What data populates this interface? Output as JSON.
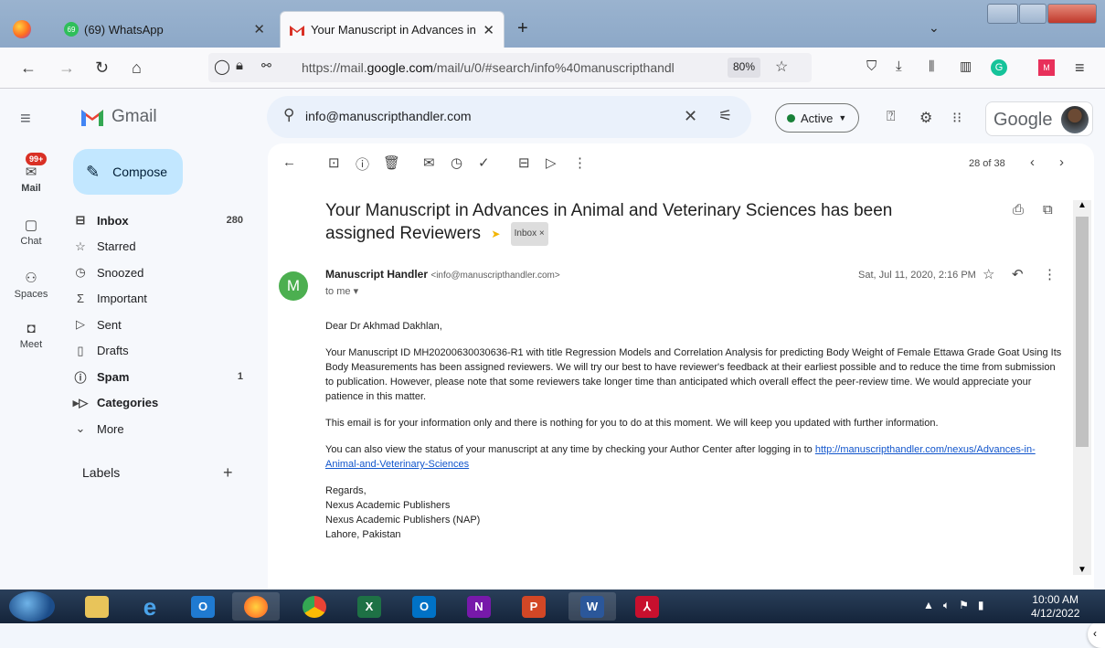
{
  "browser": {
    "tabs": [
      {
        "label": "(69) WhatsApp",
        "badge": "69"
      },
      {
        "label": "Your Manuscript in Advances in"
      }
    ],
    "url_prefix": "https://mail.",
    "url_domain": "google.com",
    "url_suffix": "/mail/u/0/#search/info%40manuscripthandl",
    "zoom": "80%"
  },
  "gmail": {
    "app_name": "Gmail",
    "rail": [
      {
        "label": "Mail",
        "badge": "99+"
      },
      {
        "label": "Chat"
      },
      {
        "label": "Spaces"
      },
      {
        "label": "Meet"
      }
    ],
    "compose_label": "Compose",
    "nav": [
      {
        "label": "Inbox",
        "count": "280",
        "bold": true,
        "icon": "inbox-icon"
      },
      {
        "label": "Starred",
        "count": "",
        "bold": false,
        "icon": "star-icon"
      },
      {
        "label": "Snoozed",
        "count": "",
        "bold": false,
        "icon": "clock-icon"
      },
      {
        "label": "Important",
        "count": "",
        "bold": false,
        "icon": "important-icon"
      },
      {
        "label": "Sent",
        "count": "",
        "bold": false,
        "icon": "send-icon"
      },
      {
        "label": "Drafts",
        "count": "",
        "bold": false,
        "icon": "draft-icon"
      },
      {
        "label": "Spam",
        "count": "1",
        "bold": true,
        "icon": "spam-icon"
      },
      {
        "label": "Categories",
        "count": "",
        "bold": true,
        "icon": "label-icon"
      },
      {
        "label": "More",
        "count": "",
        "bold": false,
        "icon": "chevron-down-icon"
      }
    ],
    "labels_heading": "Labels",
    "search_value": "info@manuscripthandler.com",
    "status": "Active",
    "account_brand": "Google",
    "pager": "28 of 38",
    "email": {
      "subject": "Your Manuscript in Advances in Animal and Veterinary Sciences has been assigned Reviewers",
      "label_chip": "Inbox ×",
      "avatar_letter": "M",
      "sender_name": "Manuscript Handler",
      "sender_email": "<info@manuscripthandler.com>",
      "to": "to me",
      "date": "Sat, Jul 11, 2020, 2:16 PM",
      "greeting": "Dear Dr Akhmad Dakhlan,",
      "para1": "Your Manuscript ID MH20200630030636-R1 with title Regression Models and Correlation Analysis for predicting Body Weight of Female Ettawa Grade Goat Using Its Body Measurements has been assigned reviewers. We will try our best to have reviewer's feedback at their earliest possible and to reduce the time from submission to publication. However, please note that some reviewers take longer time than anticipated which overall effect the peer-review time. We would appreciate your patience in this matter.",
      "para2": "This email is for your information only and there is nothing for you to do at this moment. We will keep you updated with further information.",
      "para3": "You can also view the status of your manuscript at any time by checking your Author Center after logging in to",
      "link": "http://manuscripthandler.com/nexus/Advances-in-Animal-and-Veterinary-Sciences",
      "sign": [
        "Regards,",
        "Nexus Academic Publishers",
        "Nexus Academic Publishers (NAP)",
        "Lahore, Pakistan"
      ]
    }
  },
  "taskbar": {
    "time": "10:00 AM",
    "date": "4/12/2022"
  }
}
